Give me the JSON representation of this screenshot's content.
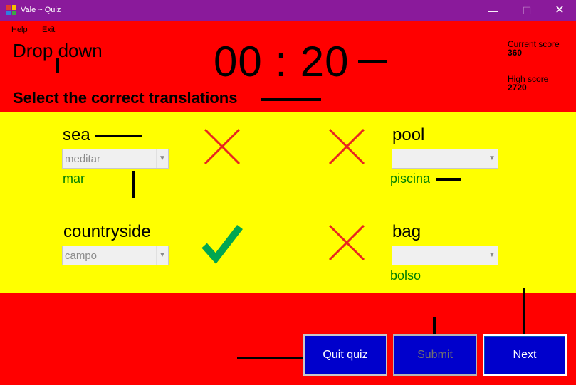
{
  "window": {
    "title": "Vale ~ Quiz",
    "min_glyph": "—",
    "max_glyph": "☐",
    "close_glyph": "✕"
  },
  "menu": {
    "help": "Help",
    "exit": "Exit"
  },
  "header": {
    "title": "Drop down",
    "timer": "00 : 20",
    "subtitle": "Select the correct translations"
  },
  "scores": {
    "current_label": "Current score",
    "current_value": "360",
    "high_label": "High score",
    "high_value": "2720"
  },
  "items": [
    {
      "word": "sea",
      "selected": "meditar",
      "answer": "mar",
      "result": "incorrect"
    },
    {
      "word": "pool",
      "selected": "",
      "answer": "piscina",
      "result": "incorrect"
    },
    {
      "word": "countryside",
      "selected": "campo",
      "answer": "",
      "result": "correct"
    },
    {
      "word": "bag",
      "selected": "",
      "answer": "bolso",
      "result": "incorrect"
    }
  ],
  "buttons": {
    "quit": "Quit quiz",
    "submit": "Submit",
    "next": "Next"
  },
  "colors": {
    "titlebar": "#8a1a9b",
    "background": "#ff0000",
    "band": "#ffff00",
    "button": "#0000cc",
    "answer": "#008000",
    "cross": "#e8261f",
    "tick": "#00a651"
  }
}
